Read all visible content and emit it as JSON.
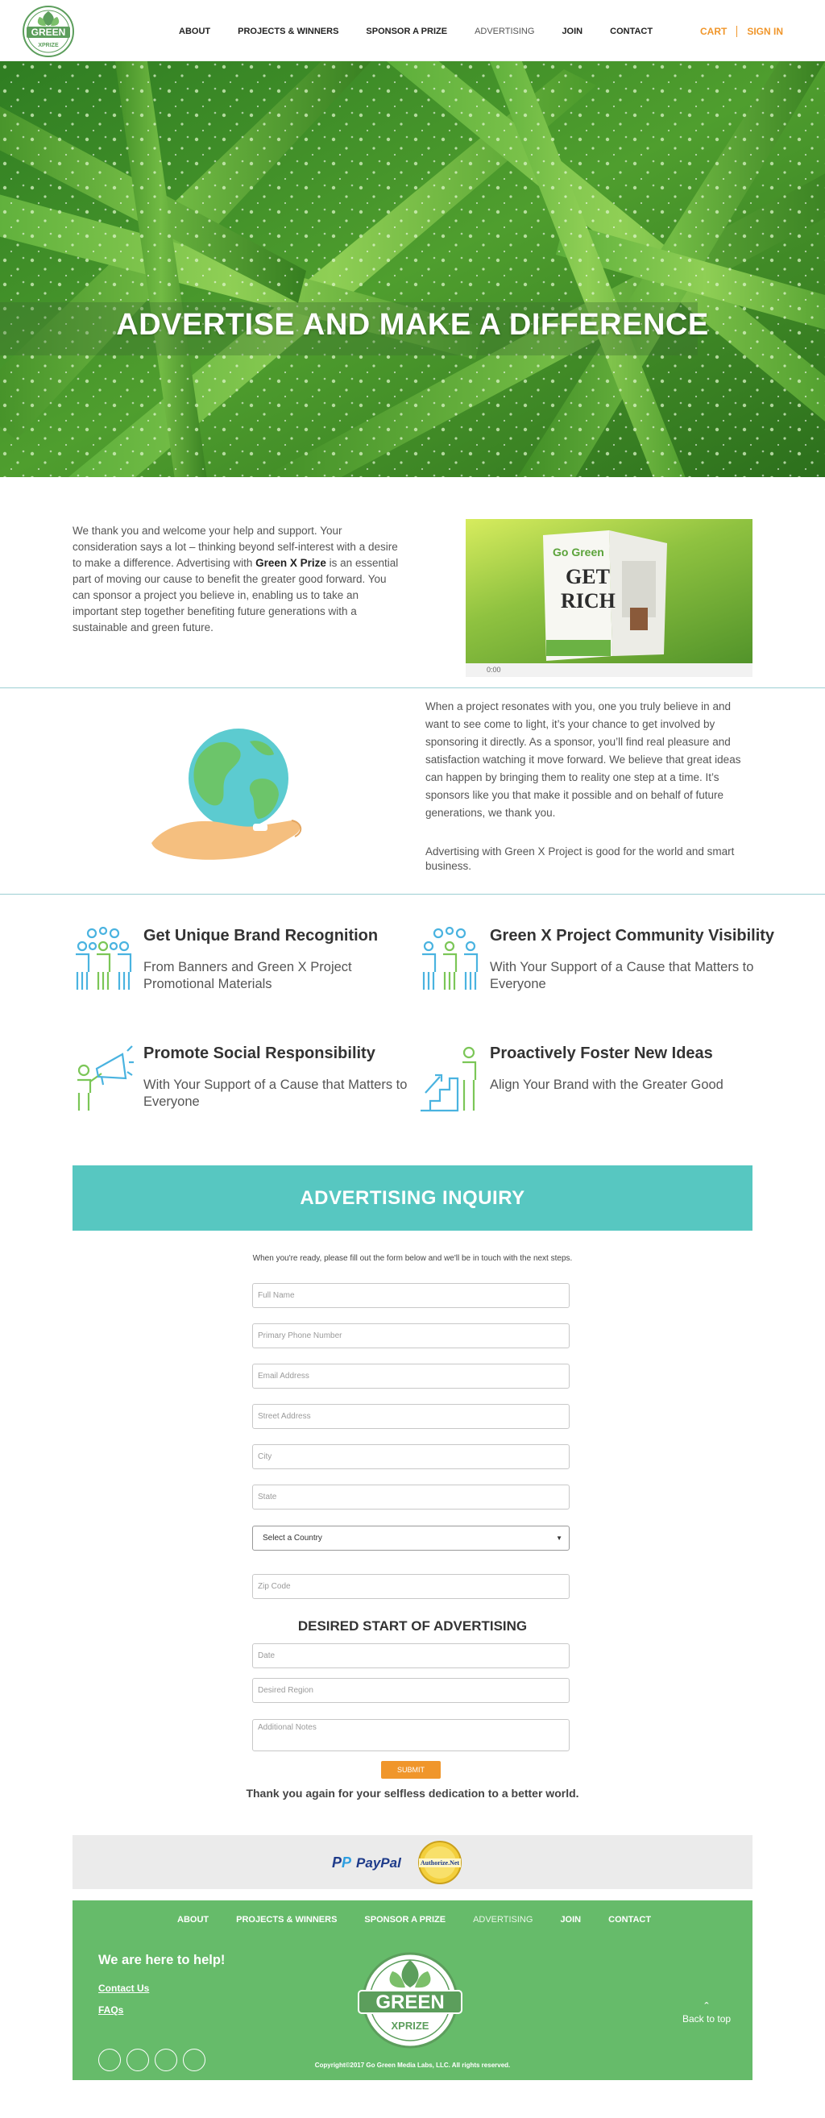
{
  "header": {
    "logo_text": "GREEN",
    "logo_sub": "XPRIZE",
    "nav": [
      "ABOUT",
      "PROJECTS & WINNERS",
      "SPONSOR A PRIZE",
      "ADVERTISING",
      "JOIN",
      "CONTACT"
    ],
    "cart": "CART",
    "sign_in": "SIGN IN"
  },
  "hero": {
    "title": "ADVERTISE AND MAKE A DIFFERENCE"
  },
  "intro": {
    "text_before": "We thank you and welcome your help and support.  Your consideration says a lot –  thinking beyond self-interest with a desire to make a difference.  Advertising with ",
    "text_bold": "Green X Prize",
    "text_after": " is an essential part of moving our cause to benefit the greater good forward. You can sponsor a project you believe in, enabling us to take an important step together benefiting future generations with a sustainable and green future.",
    "video_time": "0:00",
    "book_title_1": "Go Green",
    "book_title_2": "GET",
    "book_title_3": "RICH"
  },
  "earth": {
    "paragraph1": "When a project resonates with you, one you truly believe in and want to see come to light, it’s your chance to get involved by sponsoring it directly. As a sponsor, you’ll find real pleasure and satisfaction watching it move forward.  We believe that great ideas can happen by bringing them to reality one step at a time.  It’s sponsors like you that make it possible and on behalf of future generations, we thank you.",
    "paragraph2": "Advertising with Green X Project is good for the world and smart business."
  },
  "features": [
    {
      "title": "Get Unique Brand Recognition",
      "desc": "From Banners and Green X Project Promotional Materials",
      "icon": "people-group-icon"
    },
    {
      "title": "Green X Project Community Visibility",
      "desc": "With Your Support of a Cause that Matters to Everyone",
      "icon": "people-group-icon"
    },
    {
      "title": "Promote Social Responsibility",
      "desc": "With Your Support of a Cause that Matters to Everyone",
      "icon": "megaphone-icon"
    },
    {
      "title": "Proactively Foster New Ideas",
      "desc": "Align Your Brand with the Greater Good",
      "icon": "growth-steps-icon"
    }
  ],
  "inquiry": {
    "title": "ADVERTISING INQUIRY",
    "note": "When you're ready, please fill out the form below and we'll be in touch with the next steps.",
    "placeholders": {
      "full_name": "Full Name",
      "phone": "Primary Phone Number",
      "email": "Email Address",
      "street": "Street Address",
      "city": "City",
      "state": "State",
      "zip": "Zip Code",
      "date": "Date",
      "region": "Desired Region",
      "notes": "Additional Notes"
    },
    "country_select": "Select a Country",
    "desired_title": "DESIRED START OF ADVERTISING",
    "submit": "SUBMIT",
    "thanks": "Thank you again for your selfless dedication to a better world."
  },
  "payments": {
    "paypal": "PayPal",
    "authnet": "Authorize.Net"
  },
  "footer": {
    "nav": [
      "ABOUT",
      "PROJECTS & WINNERS",
      "SPONSOR A PRIZE",
      "ADVERTISING",
      "JOIN",
      "CONTACT"
    ],
    "help": "We are here to help!",
    "contact": "Contact Us",
    "faqs": "FAQs ",
    "back_to_top": "Back to top",
    "copyright": "Copyright©2017 Go Green Media Labs, LLC. All rights reserved."
  },
  "colors": {
    "accent_orange": "#f0962b",
    "teal": "#57c7c1",
    "footer_green": "#66bb6a"
  }
}
